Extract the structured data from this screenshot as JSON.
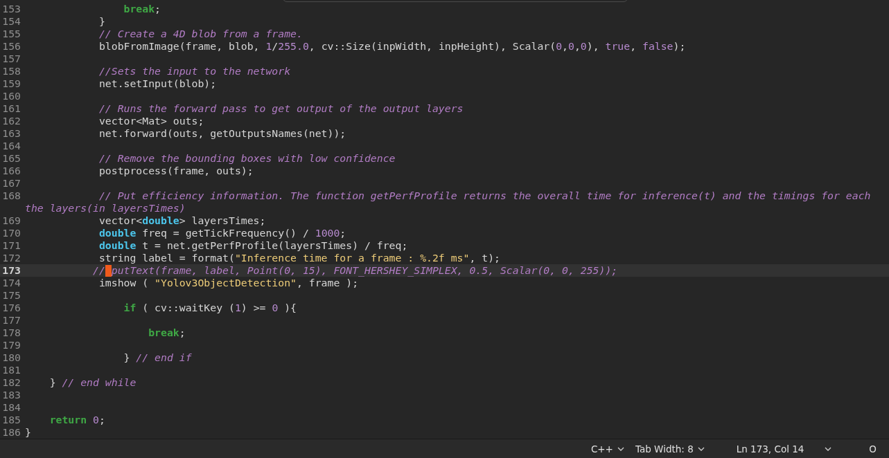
{
  "editor": {
    "lines": [
      {
        "number": "153",
        "current": false,
        "segments": [
          {
            "kind": "keyword",
            "text": "                break"
          },
          {
            "kind": "plain",
            "text": ";"
          }
        ]
      },
      {
        "number": "154",
        "current": false,
        "segments": [
          {
            "kind": "plain",
            "text": "            }"
          }
        ]
      },
      {
        "number": "155",
        "current": false,
        "segments": [
          {
            "kind": "comment",
            "text": "            // Create a 4D blob from a frame."
          }
        ]
      },
      {
        "number": "156",
        "current": false,
        "segments": [
          {
            "kind": "plain",
            "text": "            blobFromImage(frame, blob, "
          },
          {
            "kind": "number",
            "text": "1"
          },
          {
            "kind": "plain",
            "text": "/"
          },
          {
            "kind": "number",
            "text": "255.0"
          },
          {
            "kind": "plain",
            "text": ", cv::Size(inpWidth, inpHeight), Scalar("
          },
          {
            "kind": "number",
            "text": "0"
          },
          {
            "kind": "plain",
            "text": ","
          },
          {
            "kind": "number",
            "text": "0"
          },
          {
            "kind": "plain",
            "text": ","
          },
          {
            "kind": "number",
            "text": "0"
          },
          {
            "kind": "plain",
            "text": "), "
          },
          {
            "kind": "constant",
            "text": "true"
          },
          {
            "kind": "plain",
            "text": ", "
          },
          {
            "kind": "constant",
            "text": "false"
          },
          {
            "kind": "plain",
            "text": ");"
          }
        ]
      },
      {
        "number": "157",
        "current": false
      },
      {
        "number": "158",
        "current": false,
        "segments": [
          {
            "kind": "comment",
            "text": "            //Sets the input to the network"
          }
        ]
      },
      {
        "number": "159",
        "current": false,
        "segments": [
          {
            "kind": "plain",
            "text": "            net.setInput(blob);"
          }
        ]
      },
      {
        "number": "160",
        "current": false
      },
      {
        "number": "161",
        "current": false,
        "segments": [
          {
            "kind": "comment",
            "text": "            // Runs the forward pass to get output of the output layers"
          }
        ]
      },
      {
        "number": "162",
        "current": false,
        "segments": [
          {
            "kind": "plain",
            "text": "            vector<Mat> outs;"
          }
        ]
      },
      {
        "number": "163",
        "current": false,
        "segments": [
          {
            "kind": "plain",
            "text": "            net.forward(outs, getOutputsNames(net));"
          }
        ]
      },
      {
        "number": "164",
        "current": false
      },
      {
        "number": "165",
        "current": false,
        "segments": [
          {
            "kind": "comment",
            "text": "            // Remove the bounding boxes with low confidence"
          }
        ]
      },
      {
        "number": "166",
        "current": false,
        "segments": [
          {
            "kind": "plain",
            "text": "            postprocess(frame, outs);"
          }
        ]
      },
      {
        "number": "167",
        "current": false
      },
      {
        "number": "168",
        "current": false,
        "segments": [
          {
            "kind": "comment",
            "text": "            // Put efficiency information. The function getPerfProfile returns the overall time for inference(t) and the timings for each"
          }
        ],
        "wrap": [
          {
            "kind": "comment",
            "text": "the layers(in layersTimes)"
          }
        ]
      },
      {
        "number": "169",
        "current": false,
        "segments": [
          {
            "kind": "plain",
            "text": "            vector<"
          },
          {
            "kind": "type",
            "text": "double"
          },
          {
            "kind": "plain",
            "text": "> layersTimes;"
          }
        ]
      },
      {
        "number": "170",
        "current": false,
        "segments": [
          {
            "kind": "type",
            "text": "            double"
          },
          {
            "kind": "plain",
            "text": " freq = getTickFrequency() / "
          },
          {
            "kind": "number",
            "text": "1000"
          },
          {
            "kind": "plain",
            "text": ";"
          }
        ]
      },
      {
        "number": "171",
        "current": false,
        "segments": [
          {
            "kind": "type",
            "text": "            double"
          },
          {
            "kind": "plain",
            "text": " t = net.getPerfProfile(layersTimes) / freq;"
          }
        ]
      },
      {
        "number": "172",
        "current": false,
        "segments": [
          {
            "kind": "plain",
            "text": "            string label = format("
          },
          {
            "kind": "string",
            "text": "\"Inference time for a frame : %.2f ms\""
          },
          {
            "kind": "plain",
            "text": ", t);"
          }
        ]
      },
      {
        "number": "173",
        "current": true,
        "segments": [
          {
            "kind": "comment",
            "text": "           //"
          },
          {
            "kind": "comment",
            "text": " putText(frame, label, Point(0, 15), FONT_HERSHEY_SIMPLEX, 0.5, Scalar(0, 0, 255));",
            "cursor": true
          }
        ]
      },
      {
        "number": "174",
        "current": false,
        "segments": [
          {
            "kind": "plain",
            "text": "            imshow ( "
          },
          {
            "kind": "string",
            "text": "\"Yolov3ObjectDetection\""
          },
          {
            "kind": "plain",
            "text": ", frame );"
          }
        ]
      },
      {
        "number": "175",
        "current": false
      },
      {
        "number": "176",
        "current": false,
        "segments": [
          {
            "kind": "keyword",
            "text": "                if"
          },
          {
            "kind": "plain",
            "text": " ( cv::waitKey ("
          },
          {
            "kind": "number",
            "text": "1"
          },
          {
            "kind": "plain",
            "text": ") >= "
          },
          {
            "kind": "number",
            "text": "0"
          },
          {
            "kind": "plain",
            "text": " ){"
          }
        ]
      },
      {
        "number": "177",
        "current": false
      },
      {
        "number": "178",
        "current": false,
        "segments": [
          {
            "kind": "keyword",
            "text": "                    break"
          },
          {
            "kind": "plain",
            "text": ";"
          }
        ]
      },
      {
        "number": "179",
        "current": false
      },
      {
        "number": "180",
        "current": false,
        "segments": [
          {
            "kind": "plain",
            "text": "                } "
          },
          {
            "kind": "comment",
            "text": "// end if"
          }
        ]
      },
      {
        "number": "181",
        "current": false
      },
      {
        "number": "182",
        "current": false,
        "segments": [
          {
            "kind": "plain",
            "text": "    } "
          },
          {
            "kind": "comment",
            "text": "// end while"
          }
        ]
      },
      {
        "number": "183",
        "current": false
      },
      {
        "number": "184",
        "current": false
      },
      {
        "number": "185",
        "current": false,
        "segments": [
          {
            "kind": "keyword",
            "text": "    return"
          },
          {
            "kind": "number",
            "text": " 0"
          },
          {
            "kind": "plain",
            "text": ";"
          }
        ]
      },
      {
        "number": "186",
        "current": false,
        "segments": [
          {
            "kind": "plain",
            "text": "}"
          }
        ]
      }
    ]
  },
  "status_bar": [
    {
      "kind": "dropdown",
      "label": "C++"
    },
    {
      "kind": "dropdown",
      "label": "Tab Width: 8"
    },
    {
      "kind": "text",
      "label": "Ln 173, Col 14"
    },
    {
      "kind": "dropdown"
    },
    {
      "kind": "text",
      "label": "O"
    }
  ]
}
